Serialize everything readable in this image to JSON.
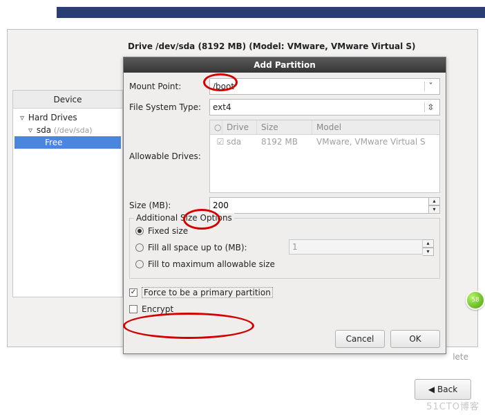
{
  "drive_label": "Drive /dev/sda (8192 MB) (Model: VMware, VMware Virtual S)",
  "device_panel": {
    "header": "Device",
    "tree": {
      "root": "Hard Drives",
      "disk": "sda",
      "disk_path": "(/dev/sda)",
      "free": "Free"
    }
  },
  "dialog": {
    "title": "Add Partition",
    "mount_point_label": "Mount Point:",
    "mount_point_value": "/boot",
    "fs_type_label": "File System Type:",
    "fs_type_value": "ext4",
    "allowable_label": "Allowable Drives:",
    "drives_table": {
      "headers": {
        "c0": "",
        "c1": "Drive",
        "c2": "Size",
        "c3": "Model"
      },
      "row": {
        "checked": "☑",
        "drive": "sda",
        "size": "8192 MB",
        "model": "VMware, VMware Virtual S"
      }
    },
    "size_label": "Size (MB):",
    "size_value": "200",
    "addl_legend": "Additional Size Options",
    "radios": {
      "fixed": "Fixed size",
      "fill_up_to": "Fill all space up to (MB):",
      "fill_up_to_value": "1",
      "fill_max": "Fill to maximum allowable size"
    },
    "primary_chk": "Force to be a primary partition",
    "encrypt_chk": "Encrypt",
    "cancel": "Cancel",
    "ok": "OK"
  },
  "delete_btn": "lete",
  "back_btn": "Back",
  "badge": "58",
  "watermark": "51CTO博客"
}
